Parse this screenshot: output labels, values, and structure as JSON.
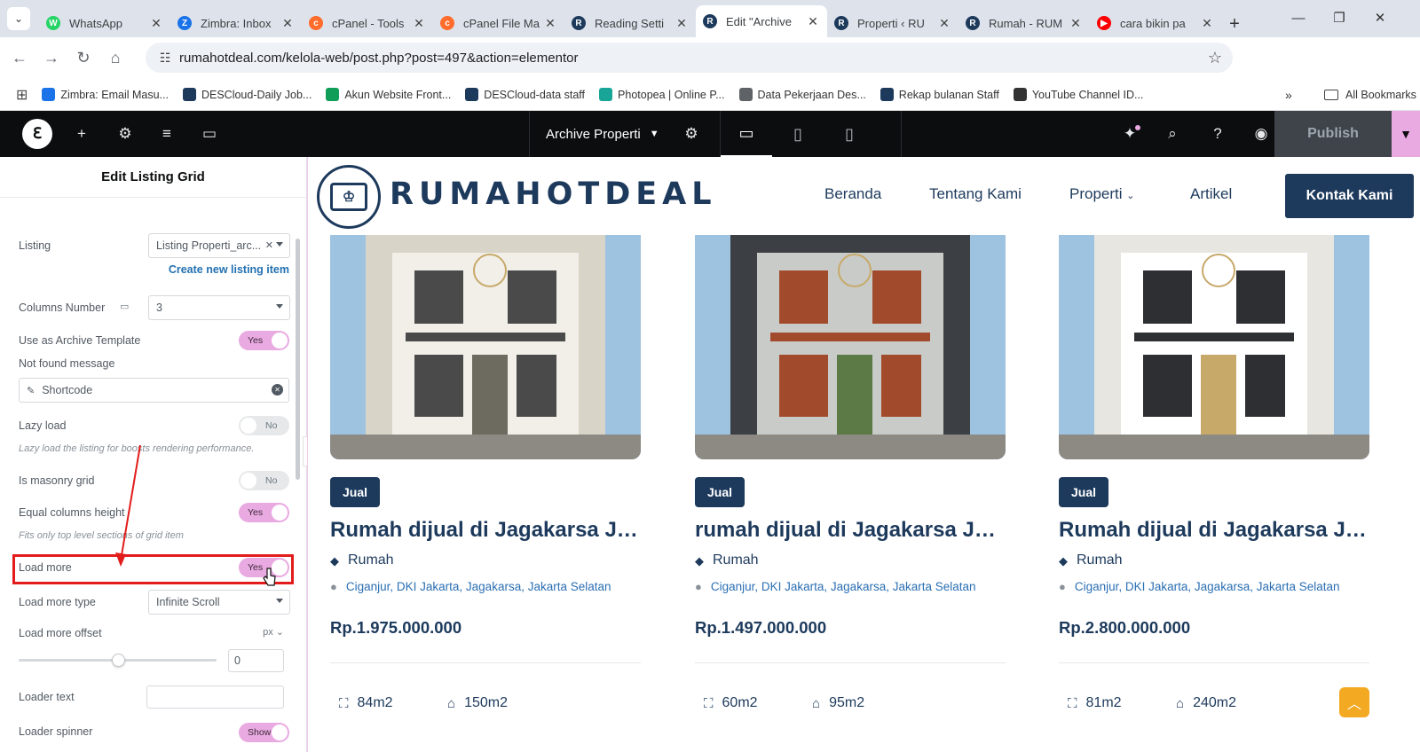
{
  "browser": {
    "tabs": [
      {
        "title": "WhatsApp",
        "fav_color": "#25d366",
        "fav_glyph": "W"
      },
      {
        "title": "Zimbra: Inbox",
        "fav_color": "#1a73e8",
        "fav_glyph": "Z"
      },
      {
        "title": "cPanel - Tools",
        "fav_color": "#ff6c2c",
        "fav_glyph": "c"
      },
      {
        "title": "cPanel File Ma",
        "fav_color": "#ff6c2c",
        "fav_glyph": "c"
      },
      {
        "title": "Reading Setti",
        "fav_color": "#1d3a5c",
        "fav_glyph": "R"
      },
      {
        "title": "Edit \"Archive",
        "fav_color": "#1d3a5c",
        "fav_glyph": "R",
        "active": true
      },
      {
        "title": "Properti ‹ RU",
        "fav_color": "#1d3a5c",
        "fav_glyph": "R"
      },
      {
        "title": "Rumah - RUM",
        "fav_color": "#1d3a5c",
        "fav_glyph": "R"
      },
      {
        "title": "cara bikin pa",
        "fav_color": "#ff0000",
        "fav_glyph": "▶"
      }
    ],
    "url": "rumahotdeal.com/kelola-web/post.php?post=497&action=elementor",
    "bookmarks": [
      {
        "label": "Zimbra: Email Masu...",
        "color": "#1a73e8"
      },
      {
        "label": "DESCloud-Daily Job...",
        "color": "#1d3a5c"
      },
      {
        "label": "Akun Website Front...",
        "color": "#0f9d58"
      },
      {
        "label": "DESCloud-data staff",
        "color": "#1d3a5c"
      },
      {
        "label": "Photopea | Online P...",
        "color": "#18a497"
      },
      {
        "label": "Data Pekerjaan Des...",
        "color": "#5f6368"
      },
      {
        "label": "Rekap bulanan Staff",
        "color": "#1d3a5c"
      },
      {
        "label": "YouTube Channel ID...",
        "color": "#333333"
      }
    ],
    "all_bookmarks": "All Bookmarks"
  },
  "editor": {
    "document_title": "Archive Properti",
    "publish_label": "Publish"
  },
  "panel": {
    "title": "Edit Listing Grid",
    "listing_label": "Listing",
    "listing_value": "Listing Properti_arc...",
    "create_link": "Create new listing item",
    "columns_label": "Columns Number",
    "columns_value": "3",
    "archive_label": "Use as Archive Template",
    "archive_value": "Yes",
    "notfound_label": "Not found message",
    "shortcode_value": "Shortcode",
    "lazy_label": "Lazy load",
    "lazy_value": "No",
    "lazy_hint": "Lazy load the listing for boosts rendering performance.",
    "masonry_label": "Is masonry grid",
    "masonry_value": "No",
    "equal_label": "Equal columns height",
    "equal_value": "Yes",
    "equal_hint": "Fits only top level sections of grid item",
    "loadmore_label": "Load more",
    "loadmore_value": "Yes",
    "loadmore_type_label": "Load more type",
    "loadmore_type_value": "Infinite Scroll",
    "offset_label": "Load more offset",
    "offset_unit": "px",
    "offset_value": "0",
    "offset_slider_fraction": 0.5,
    "loader_text_label": "Loader text",
    "loader_spinner_label": "Loader spinner",
    "loader_spinner_value": "Show"
  },
  "site": {
    "brand": "RUMAHOTDEAL",
    "nav": [
      "Beranda",
      "Tentang Kami",
      "Properti",
      "Artikel"
    ],
    "cta": "Kontak Kami",
    "cards": [
      {
        "badge": "Jual",
        "title": "Rumah dijual di Jagakarsa Jakarta Selatan",
        "category": "Rumah",
        "location": "Ciganjur, DKI Jakarta, Jagakarsa, Jakarta Selatan",
        "price": "Rp.1.975.000.000",
        "land": "84m2",
        "building": "150m2"
      },
      {
        "badge": "Jual",
        "title": "rumah dijual di Jagakarsa Jakarta Selatan",
        "category": "Rumah",
        "location": "Ciganjur, DKI Jakarta, Jagakarsa, Jakarta Selatan",
        "price": "Rp.1.497.000.000",
        "land": "60m2",
        "building": "95m2"
      },
      {
        "badge": "Jual",
        "title": "Rumah dijual di Jagakarsa Jakarta Selatan",
        "category": "Rumah",
        "location": "Ciganjur, DKI Jakarta, Jagakarsa, Jakarta Selatan",
        "price": "Rp.2.800.000.000",
        "land": "81m2",
        "building": "240m2"
      }
    ]
  }
}
